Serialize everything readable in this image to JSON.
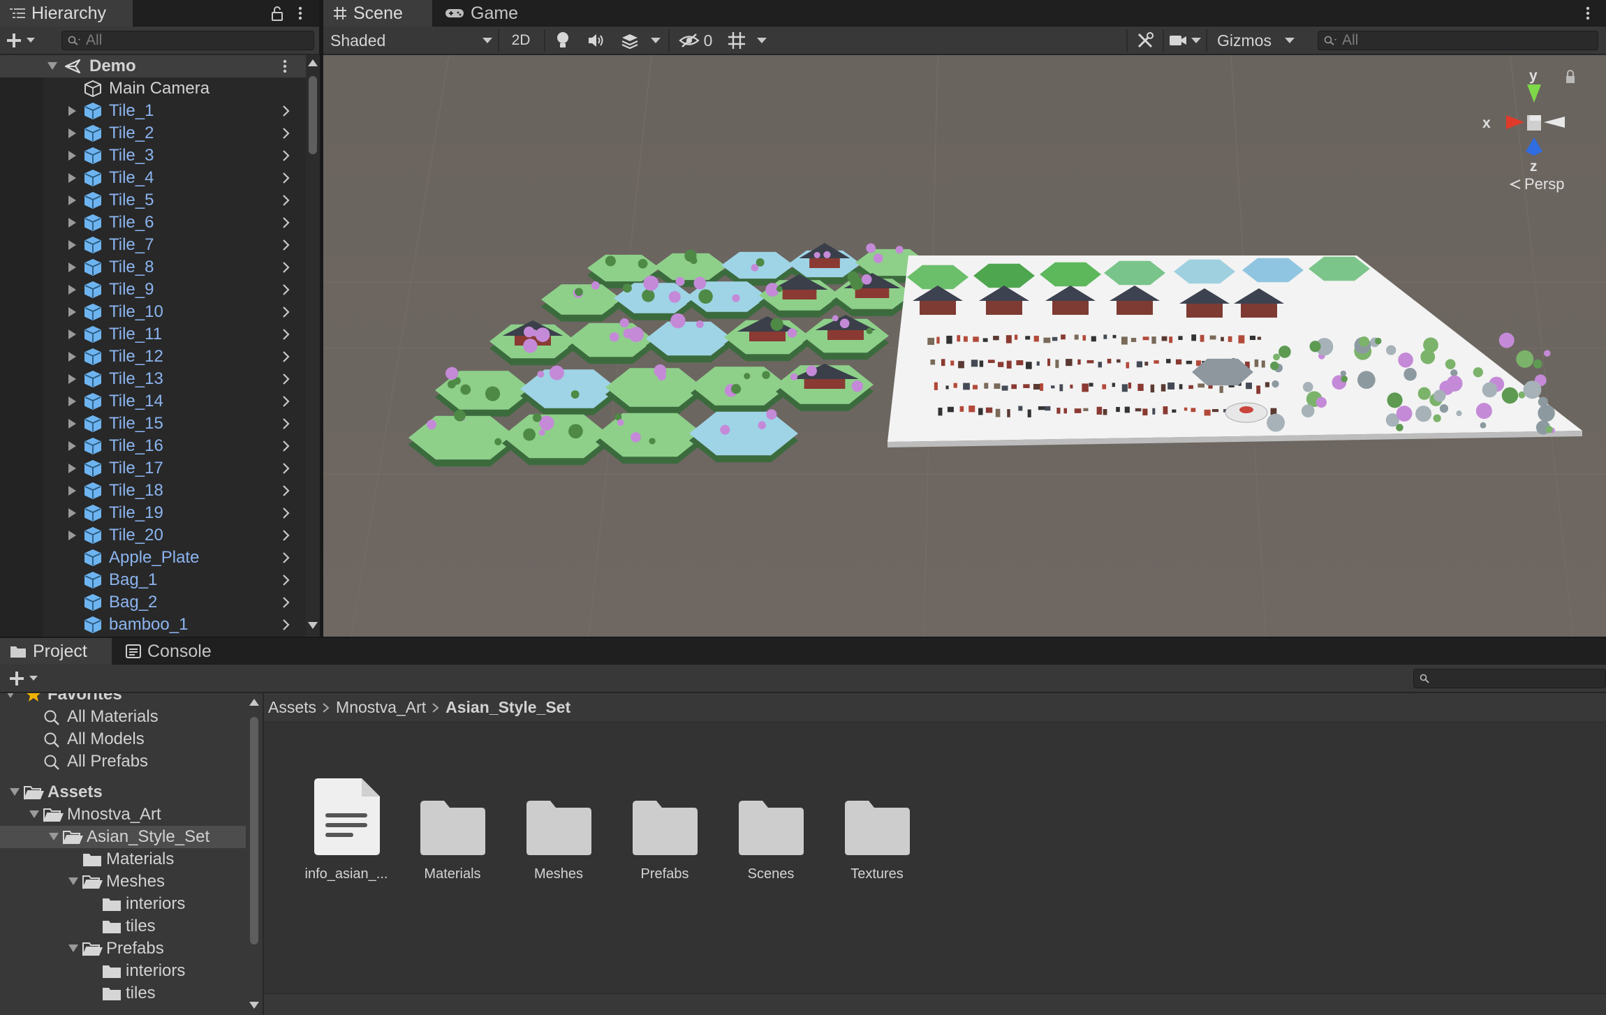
{
  "hierarchy": {
    "tab_label": "Hierarchy",
    "search_placeholder": "All",
    "root": "Demo",
    "items": [
      {
        "label": "Main Camera",
        "type": "object",
        "expandable": false
      },
      {
        "label": "Tile_1",
        "type": "prefab",
        "expandable": true
      },
      {
        "label": "Tile_2",
        "type": "prefab",
        "expandable": true
      },
      {
        "label": "Tile_3",
        "type": "prefab",
        "expandable": true
      },
      {
        "label": "Tile_4",
        "type": "prefab",
        "expandable": true
      },
      {
        "label": "Tile_5",
        "type": "prefab",
        "expandable": true
      },
      {
        "label": "Tile_6",
        "type": "prefab",
        "expandable": true
      },
      {
        "label": "Tile_7",
        "type": "prefab",
        "expandable": true
      },
      {
        "label": "Tile_8",
        "type": "prefab",
        "expandable": true
      },
      {
        "label": "Tile_9",
        "type": "prefab",
        "expandable": true
      },
      {
        "label": "Tile_10",
        "type": "prefab",
        "expandable": true
      },
      {
        "label": "Tile_11",
        "type": "prefab",
        "expandable": true
      },
      {
        "label": "Tile_12",
        "type": "prefab",
        "expandable": true
      },
      {
        "label": "Tile_13",
        "type": "prefab",
        "expandable": true
      },
      {
        "label": "Tile_14",
        "type": "prefab",
        "expandable": true
      },
      {
        "label": "Tile_15",
        "type": "prefab",
        "expandable": true
      },
      {
        "label": "Tile_16",
        "type": "prefab",
        "expandable": true
      },
      {
        "label": "Tile_17",
        "type": "prefab",
        "expandable": true
      },
      {
        "label": "Tile_18",
        "type": "prefab",
        "expandable": true
      },
      {
        "label": "Tile_19",
        "type": "prefab",
        "expandable": true
      },
      {
        "label": "Tile_20",
        "type": "prefab",
        "expandable": true
      },
      {
        "label": "Apple_Plate",
        "type": "prefab",
        "expandable": false
      },
      {
        "label": "Bag_1",
        "type": "prefab",
        "expandable": false
      },
      {
        "label": "Bag_2",
        "type": "prefab",
        "expandable": false
      },
      {
        "label": "bamboo_1",
        "type": "prefab",
        "expandable": false
      }
    ]
  },
  "scene": {
    "tabs": [
      "Scene",
      "Game"
    ],
    "shading_mode": "Shaded",
    "toggle_2d": "2D",
    "hidden_count": "0",
    "gizmos_label": "Gizmos",
    "search_placeholder": "All",
    "gizmo": {
      "x": "x",
      "y": "y",
      "z": "z",
      "projection": "Persp"
    }
  },
  "project": {
    "tabs": [
      "Project",
      "Console"
    ],
    "favorites_label": "Favorites",
    "favorites": [
      "All Materials",
      "All Models",
      "All Prefabs"
    ],
    "tree": [
      {
        "label": "Assets",
        "depth": 0,
        "expanded": true,
        "bold": true
      },
      {
        "label": "Mnostva_Art",
        "depth": 1,
        "expanded": true
      },
      {
        "label": "Asian_Style_Set",
        "depth": 2,
        "expanded": true,
        "selected": true
      },
      {
        "label": "Materials",
        "depth": 3,
        "expanded": null
      },
      {
        "label": "Meshes",
        "depth": 3,
        "expanded": true
      },
      {
        "label": "interiors",
        "depth": 4,
        "expanded": null
      },
      {
        "label": "tiles",
        "depth": 4,
        "expanded": null
      },
      {
        "label": "Prefabs",
        "depth": 3,
        "expanded": true
      },
      {
        "label": "interiors",
        "depth": 4,
        "expanded": null
      },
      {
        "label": "tiles",
        "depth": 4,
        "expanded": null
      }
    ],
    "breadcrumb": [
      "Assets",
      "Mnostva_Art",
      "Asian_Style_Set"
    ],
    "assets": [
      {
        "label": "info_asian_...",
        "kind": "document"
      },
      {
        "label": "Materials",
        "kind": "folder"
      },
      {
        "label": "Meshes",
        "kind": "folder"
      },
      {
        "label": "Prefabs",
        "kind": "folder"
      },
      {
        "label": "Scenes",
        "kind": "folder"
      },
      {
        "label": "Textures",
        "kind": "folder"
      }
    ]
  },
  "colors": {
    "prefab_text": "#8cb5f0",
    "prefab_icon": "#6eb4f0",
    "viewport_bg": "#6d6660",
    "tile_green": "#8ed08a",
    "blossom": "#c48ad8"
  }
}
